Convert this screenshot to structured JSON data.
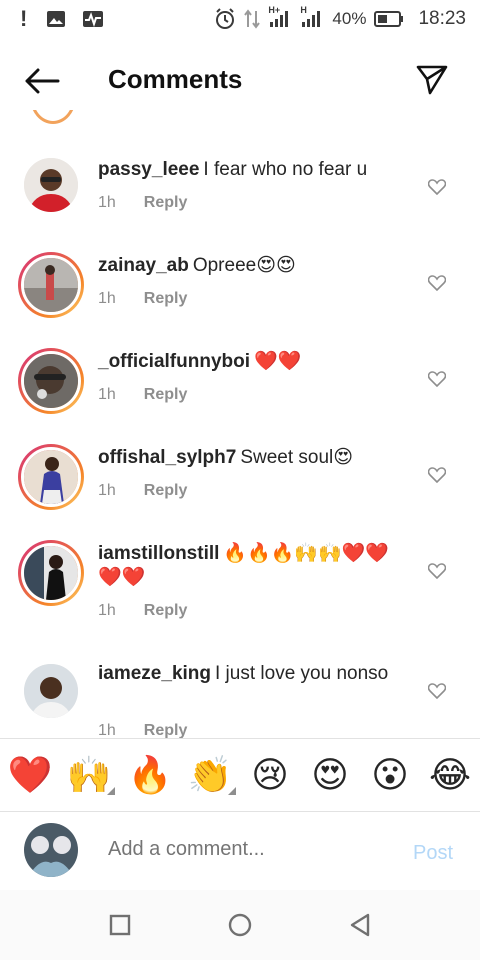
{
  "status_bar": {
    "alert_icon": "exclamation-icon",
    "signal_1_label": "H+",
    "signal_2_label": "H",
    "battery_percent": "40%",
    "time": "18:23"
  },
  "header": {
    "title": "Comments",
    "back_icon": "arrow-left-icon",
    "share_icon": "paper-plane-icon"
  },
  "comments": [
    {
      "username": "passy_leee",
      "text": "I fear who no fear u",
      "time": "1h",
      "reply_label": "Reply"
    },
    {
      "username": "zainay_ab",
      "text": "Opreee😍😍",
      "time": "1h",
      "reply_label": "Reply"
    },
    {
      "username": "_officialfunnyboi",
      "text": "❤️❤️",
      "time": "1h",
      "reply_label": "Reply"
    },
    {
      "username": "offishal_sylph7",
      "text": "Sweet soul😍",
      "time": "1h",
      "reply_label": "Reply"
    },
    {
      "username": "iamstillonstill",
      "text": "🔥🔥🔥🙌🙌❤️❤️❤️❤️",
      "time": "1h",
      "reply_label": "Reply"
    },
    {
      "username": "iameze_king",
      "text": "I just love you nonso",
      "time": "1h",
      "reply_label": "Reply"
    }
  ],
  "emoji_bar": [
    "❤️",
    "🙌",
    "🔥",
    "👏",
    "😢",
    "😍",
    "😮",
    "😂"
  ],
  "composer": {
    "placeholder": "Add a comment...",
    "post_label": "Post"
  },
  "colors": {
    "ring_start": "#d6307a",
    "ring_end": "#feda75",
    "post_disabled": "#b3d7f7",
    "secondary_text": "#8e8e8e"
  }
}
